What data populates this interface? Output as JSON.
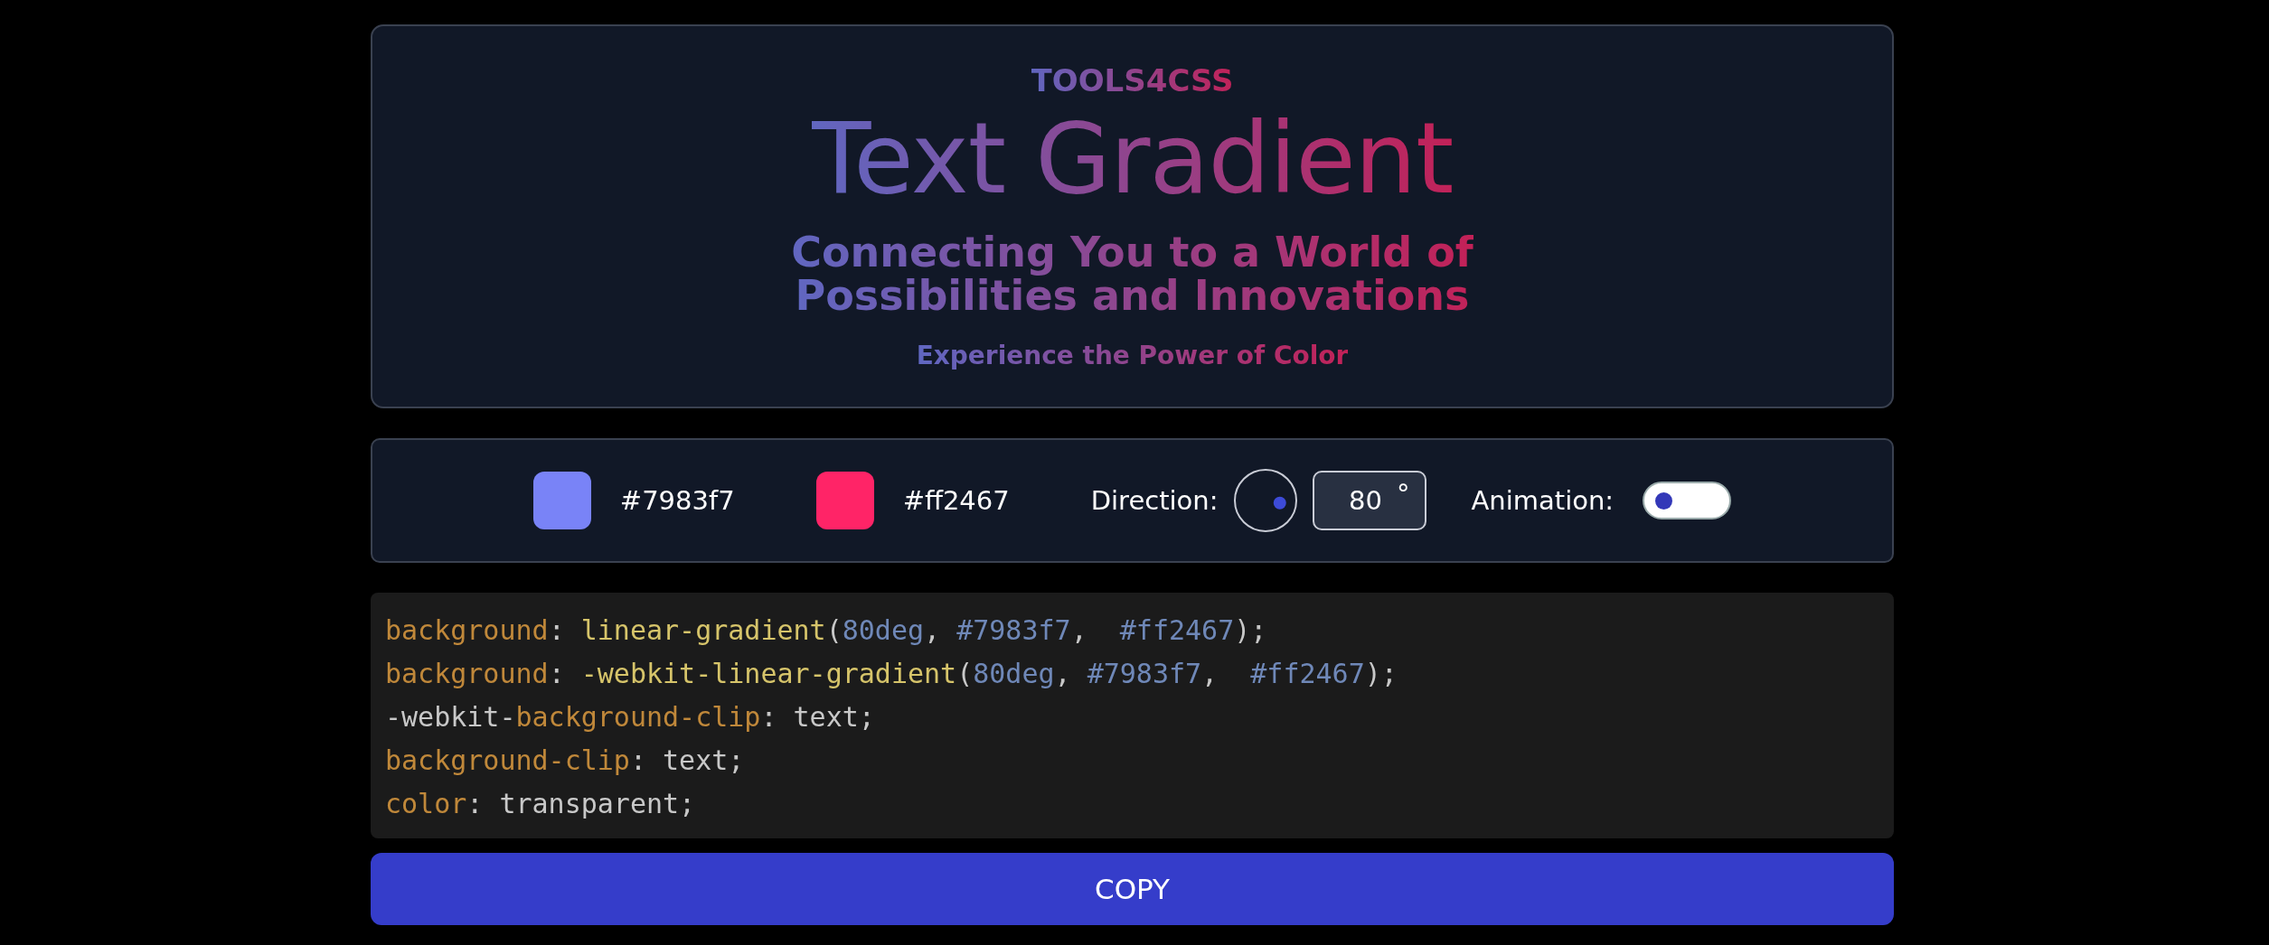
{
  "preview": {
    "brand": "TOOLS4CSS",
    "title": "Text Gradient",
    "subtitle_lines": [
      "Connecting You to a World of",
      "Possibilities and Innovations"
    ],
    "tagline": "Experience the Power of Color"
  },
  "controls": {
    "colors": [
      {
        "color": "#7983f7",
        "value": "#7983f7"
      },
      {
        "color": "#ff2467",
        "value": "#ff2467"
      }
    ],
    "direction": {
      "label": "Direction:",
      "value": "80",
      "unit": "°"
    },
    "animation": {
      "label": "Animation:",
      "on": false
    }
  },
  "code": [
    [
      {
        "kind": "prop",
        "text": "background"
      },
      {
        "kind": "plain",
        "text": ": "
      },
      {
        "kind": "func",
        "text": "linear-gradient"
      },
      {
        "kind": "plain",
        "text": "("
      },
      {
        "kind": "num",
        "text": "80deg"
      },
      {
        "kind": "plain",
        "text": ", "
      },
      {
        "kind": "num",
        "text": "#7983f7"
      },
      {
        "kind": "plain",
        "text": ",  "
      },
      {
        "kind": "num",
        "text": "#ff2467"
      },
      {
        "kind": "plain",
        "text": ");"
      }
    ],
    [
      {
        "kind": "prop",
        "text": "background"
      },
      {
        "kind": "plain",
        "text": ": "
      },
      {
        "kind": "func",
        "text": "-webkit-linear-gradient"
      },
      {
        "kind": "plain",
        "text": "("
      },
      {
        "kind": "num",
        "text": "80deg"
      },
      {
        "kind": "plain",
        "text": ", "
      },
      {
        "kind": "num",
        "text": "#7983f7"
      },
      {
        "kind": "plain",
        "text": ",  "
      },
      {
        "kind": "num",
        "text": "#ff2467"
      },
      {
        "kind": "plain",
        "text": ");"
      }
    ],
    [
      {
        "kind": "plain",
        "text": "-webkit-"
      },
      {
        "kind": "prop",
        "text": "background-clip"
      },
      {
        "kind": "plain",
        "text": ": text;"
      }
    ],
    [
      {
        "kind": "prop",
        "text": "background-clip"
      },
      {
        "kind": "plain",
        "text": ": text;"
      }
    ],
    [
      {
        "kind": "prop",
        "text": "color"
      },
      {
        "kind": "plain",
        "text": ": transparent;"
      }
    ]
  ],
  "copy_button": "COPY"
}
